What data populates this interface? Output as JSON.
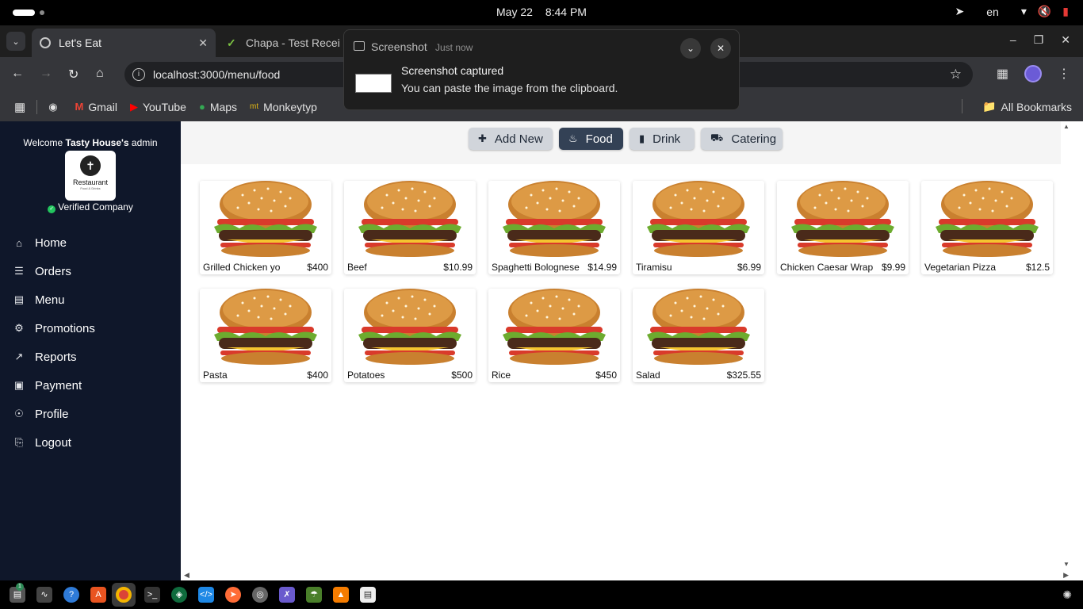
{
  "os": {
    "date": "May 22",
    "time": "8:44 PM",
    "lang": "en"
  },
  "browser": {
    "tabs": [
      {
        "title": "Let's Eat",
        "active": true
      },
      {
        "title": "Chapa - Test Recei",
        "active": false
      }
    ],
    "url": "localhost:3000/menu/food",
    "bookmarks": [
      {
        "label": "Gmail",
        "icon": "gmail-icon"
      },
      {
        "label": "YouTube",
        "icon": "youtube-icon"
      },
      {
        "label": "Maps",
        "icon": "maps-icon"
      },
      {
        "label": "Monkeytyp",
        "icon": "monkeytype-icon"
      }
    ],
    "all_bookmarks": "All Bookmarks"
  },
  "notification": {
    "app": "Screenshot",
    "time": "Just now",
    "title": "Screenshot captured",
    "body": "You can paste the image from the clipboard."
  },
  "sidebar": {
    "welcome_prefix": "Welcome",
    "company": "Tasty House's",
    "welcome_suffix": "admin",
    "logo_text": "Restaurant",
    "logo_subtext": "Food & Drinks",
    "verified": "Verified Company",
    "items": [
      {
        "label": "Home",
        "icon": "home-icon"
      },
      {
        "label": "Orders",
        "icon": "list-icon"
      },
      {
        "label": "Menu",
        "icon": "menu-book-icon"
      },
      {
        "label": "Promotions",
        "icon": "promotions-icon"
      },
      {
        "label": "Reports",
        "icon": "chart-icon"
      },
      {
        "label": "Payment",
        "icon": "payment-icon"
      },
      {
        "label": "Profile",
        "icon": "profile-icon"
      },
      {
        "label": "Logout",
        "icon": "logout-icon"
      }
    ]
  },
  "menu_tabs": [
    {
      "label": "Add New",
      "icon": "plus-icon",
      "active": false
    },
    {
      "label": "Food",
      "icon": "food-icon",
      "active": true
    },
    {
      "label": "Drink",
      "icon": "drink-icon",
      "active": false
    },
    {
      "label": "Catering",
      "icon": "truck-icon",
      "active": false
    }
  ],
  "items": [
    {
      "name": "Grilled Chicken yo",
      "price": "$400"
    },
    {
      "name": "Beef",
      "price": "$10.99"
    },
    {
      "name": "Spaghetti Bolognese",
      "price": "$14.99"
    },
    {
      "name": "Tiramisu",
      "price": "$6.99"
    },
    {
      "name": "Chicken Caesar Wrap",
      "price": "$9.99"
    },
    {
      "name": "Vegetarian Pizza",
      "price": "$12.5"
    },
    {
      "name": "Pasta",
      "price": "$400"
    },
    {
      "name": "Potatoes",
      "price": "$500"
    },
    {
      "name": "Rice",
      "price": "$450"
    },
    {
      "name": "Salad",
      "price": "$325.55"
    }
  ],
  "colors": {
    "sidebar_bg": "#0f172a",
    "active_tab": "#334155",
    "inactive_tab": "#d1d5db",
    "verified": "#22c55e"
  },
  "taskbar": {
    "files_badge": "1"
  }
}
